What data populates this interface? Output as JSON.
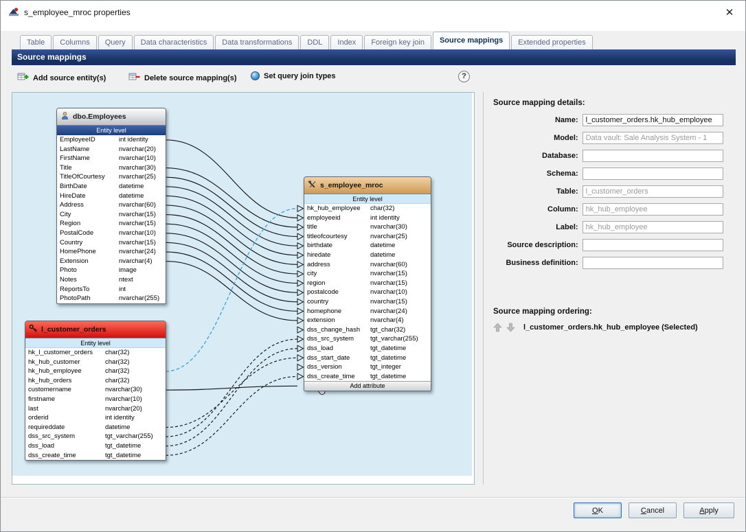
{
  "window": {
    "title": "s_employee_mroc properties",
    "close_glyph": "✕"
  },
  "tabs": [
    "Table",
    "Columns",
    "Query",
    "Data characteristics",
    "Data transformations",
    "DDL",
    "Index",
    "Foreign key join",
    "Source mappings",
    "Extended properties"
  ],
  "active_tab": "Source mappings",
  "section_title": "Source mappings",
  "toolbar": {
    "add": "Add source entity(s)",
    "delete": "Delete source mapping(s)",
    "join": "Set query join types",
    "help": "?"
  },
  "icons": {
    "app": "app-logo-icon",
    "close": "close-icon",
    "add_entity": "table-plus-icon",
    "delete_mapping": "table-minus-icon",
    "join_types": "blue-orb-icon",
    "help": "question-mark-icon",
    "move_up": "up-arrow-icon",
    "move_down": "down-arrow-icon",
    "cursor": "hand-pointer-icon"
  },
  "colors": {
    "header_bar": "#16305f",
    "canvas": "#d9ecf6",
    "employees_header": "#bfc3c7",
    "target_header": "#cf9a56",
    "orders_header": "#d40f0f",
    "entity_level_dark": "#1c3f7a",
    "entity_level_light": "#cfe9f8",
    "selected_mapping": "#3da0d8"
  },
  "entities": {
    "employees": {
      "title": "dbo.Employees",
      "icon": "person-icon",
      "level": "Entity level",
      "level_style": "dark",
      "attrs": [
        [
          "EmployeeID",
          "int identity"
        ],
        [
          "LastName",
          "nvarchar(20)"
        ],
        [
          "FirstName",
          "nvarchar(10)"
        ],
        [
          "Title",
          "nvarchar(30)"
        ],
        [
          "TitleOfCourtesy",
          "nvarchar(25)"
        ],
        [
          "BirthDate",
          "datetime"
        ],
        [
          "HireDate",
          "datetime"
        ],
        [
          "Address",
          "nvarchar(60)"
        ],
        [
          "City",
          "nvarchar(15)"
        ],
        [
          "Region",
          "nvarchar(15)"
        ],
        [
          "PostalCode",
          "nvarchar(10)"
        ],
        [
          "Country",
          "nvarchar(15)"
        ],
        [
          "HomePhone",
          "nvarchar(24)"
        ],
        [
          "Extension",
          "nvarchar(4)"
        ],
        [
          "Photo",
          "image"
        ],
        [
          "Notes",
          "ntext"
        ],
        [
          "ReportsTo",
          "int"
        ],
        [
          "PhotoPath",
          "nvarchar(255)"
        ]
      ]
    },
    "target": {
      "title": "s_employee_mroc",
      "icon": "tools-icon",
      "level": "Entity level",
      "level_style": "light",
      "attrs": [
        [
          "hk_hub_employee",
          "char(32)"
        ],
        [
          "employeeid",
          "int identity"
        ],
        [
          "title",
          "nvarchar(30)"
        ],
        [
          "titleofcourtesy",
          "nvarchar(25)"
        ],
        [
          "birthdate",
          "datetime"
        ],
        [
          "hiredate",
          "datetime"
        ],
        [
          "address",
          "nvarchar(60)"
        ],
        [
          "city",
          "nvarchar(15)"
        ],
        [
          "region",
          "nvarchar(15)"
        ],
        [
          "postalcode",
          "nvarchar(10)"
        ],
        [
          "country",
          "nvarchar(15)"
        ],
        [
          "homephone",
          "nvarchar(24)"
        ],
        [
          "extension",
          "nvarchar(4)"
        ],
        [
          "dss_change_hash",
          "tgt_char(32)"
        ],
        [
          "dss_src_system",
          "tgt_varchar(255)"
        ],
        [
          "dss_load",
          "tgt_datetime"
        ],
        [
          "dss_start_date",
          "tgt_datetime"
        ],
        [
          "dss_version",
          "tgt_integer"
        ],
        [
          "dss_create_time",
          "tgt_datetime"
        ]
      ],
      "footer": "Add attribute"
    },
    "orders": {
      "title": "l_customer_orders",
      "icon": "key-icon",
      "level": "Entity level",
      "level_style": "light",
      "attrs": [
        [
          "hk_l_customer_orders",
          "char(32)"
        ],
        [
          "hk_hub_customer",
          "char(32)"
        ],
        [
          "hk_hub_employee",
          "char(32)"
        ],
        [
          "hk_hub_orders",
          "char(32)"
        ],
        [
          "customername",
          "nvarchar(30)"
        ],
        [
          "firstname",
          "nvarchar(10)"
        ],
        [
          "last",
          "nvarchar(20)"
        ],
        [
          "orderid",
          "int identity"
        ],
        [
          "requireddate",
          "datetime"
        ],
        [
          "dss_src_system",
          "tgt_varchar(255)"
        ],
        [
          "dss_load",
          "tgt_datetime"
        ],
        [
          "dss_create_time",
          "tgt_datetime"
        ]
      ]
    }
  },
  "connections": [
    {
      "from": "employees.EmployeeID",
      "to": "target.employeeid",
      "style": "solid"
    },
    {
      "from": "employees.Title",
      "to": "target.title",
      "style": "solid"
    },
    {
      "from": "employees.TitleOfCourtesy",
      "to": "target.titleofcourtesy",
      "style": "solid"
    },
    {
      "from": "employees.BirthDate",
      "to": "target.birthdate",
      "style": "solid"
    },
    {
      "from": "employees.HireDate",
      "to": "target.hiredate",
      "style": "solid"
    },
    {
      "from": "employees.Address",
      "to": "target.address",
      "style": "solid"
    },
    {
      "from": "employees.City",
      "to": "target.city",
      "style": "solid"
    },
    {
      "from": "employees.Region",
      "to": "target.region",
      "style": "solid"
    },
    {
      "from": "employees.PostalCode",
      "to": "target.postalcode",
      "style": "solid"
    },
    {
      "from": "employees.Country",
      "to": "target.country",
      "style": "solid"
    },
    {
      "from": "employees.HomePhone",
      "to": "target.homephone",
      "style": "solid"
    },
    {
      "from": "employees.Extension",
      "to": "target.extension",
      "style": "solid"
    },
    {
      "from": "orders.hk_hub_employee",
      "to": "target.hk_hub_employee",
      "style": "selected-dashed"
    },
    {
      "from": "orders.requireddate",
      "to": "target.dss_start_date",
      "style": "dashed"
    },
    {
      "from": "orders.dss_src_system",
      "to": "target.dss_src_system",
      "style": "dashed"
    },
    {
      "from": "orders.dss_load",
      "to": "target.dss_load",
      "style": "dashed"
    },
    {
      "from": "orders.dss_create_time",
      "to": "target.dss_create_time",
      "style": "dashed"
    },
    {
      "from": "orders.customername",
      "to": "target.__footer",
      "style": "solid"
    }
  ],
  "details": {
    "title": "Source mapping details:",
    "fields": [
      {
        "key": "name",
        "label": "Name:",
        "value": "l_customer_orders.hk_hub_employee",
        "muted": false
      },
      {
        "key": "model",
        "label": "Model:",
        "value": "Data vault: Sale Analysis System - 1",
        "muted": true
      },
      {
        "key": "database",
        "label": "Database:",
        "value": "",
        "muted": false
      },
      {
        "key": "schema",
        "label": "Schema:",
        "value": "",
        "muted": false
      },
      {
        "key": "table",
        "label": "Table:",
        "value": "l_customer_orders",
        "muted": true
      },
      {
        "key": "column",
        "label": "Column:",
        "value": "hk_hub_employee",
        "muted": true
      },
      {
        "key": "label",
        "label": "Label:",
        "value": "hk_hub_employee",
        "muted": true
      },
      {
        "key": "source_description",
        "label": "Source description:",
        "value": "",
        "muted": false
      },
      {
        "key": "business_definition",
        "label": "Business definition:",
        "value": "",
        "muted": false
      }
    ],
    "ordering_title": "Source mapping ordering:",
    "ordering_item": "l_customer_orders.hk_hub_employee (Selected)"
  },
  "footer": {
    "ok": "OK",
    "cancel": "Cancel",
    "apply": "Apply"
  }
}
